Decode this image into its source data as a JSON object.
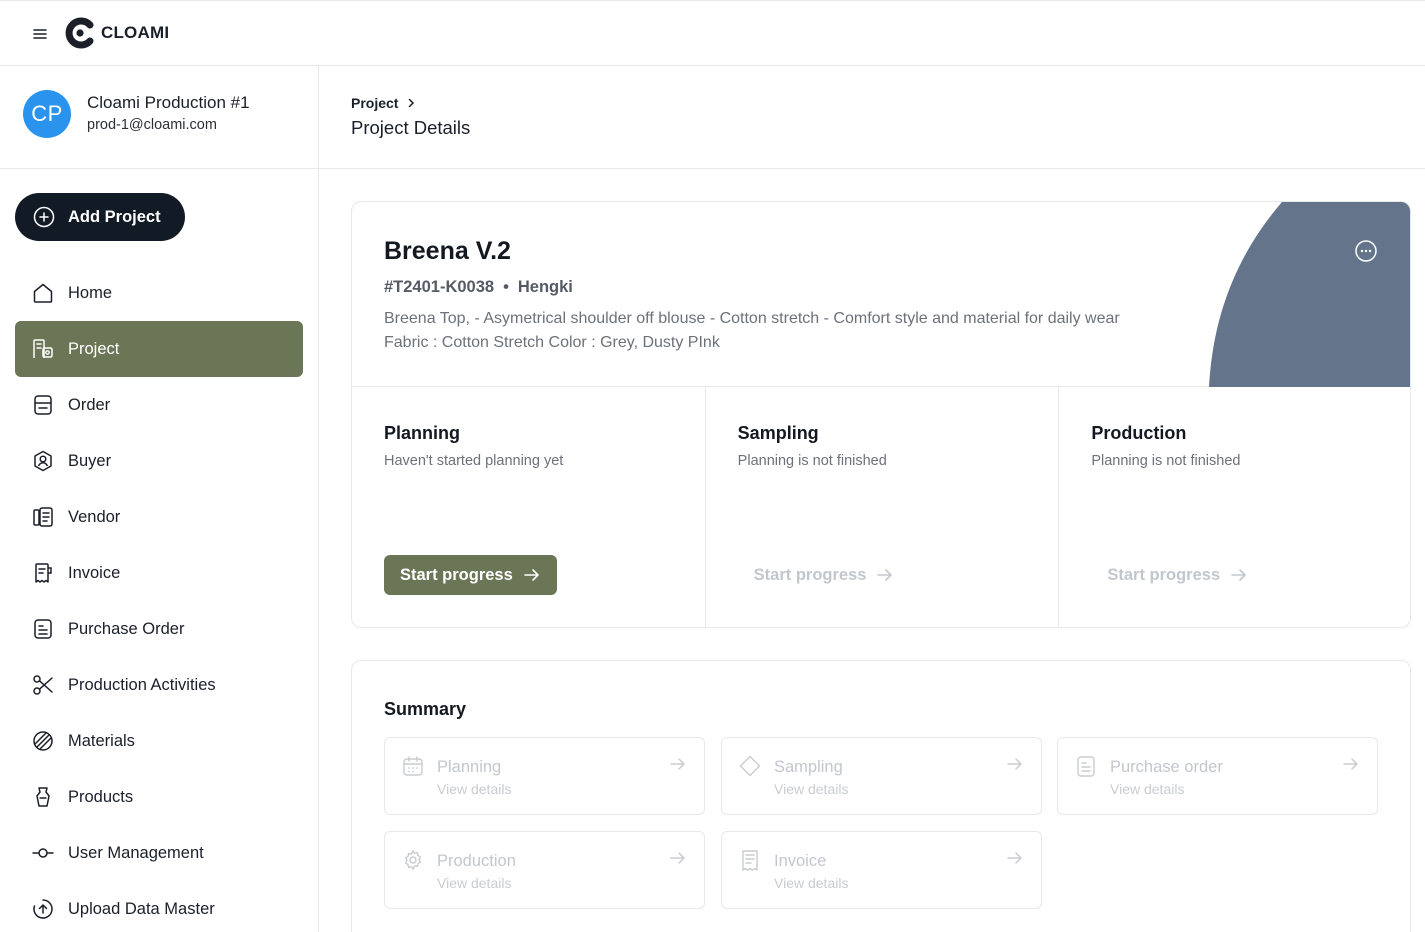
{
  "brand": {
    "name": "CLOAMI"
  },
  "user": {
    "initials": "CP",
    "name": "Cloami Production #1",
    "email": "prod-1@cloami.com"
  },
  "sidebar": {
    "add_label": "Add Project",
    "items": [
      {
        "label": "Home",
        "icon": "home-icon"
      },
      {
        "label": "Project",
        "icon": "project-icon",
        "active": true
      },
      {
        "label": "Order",
        "icon": "order-icon"
      },
      {
        "label": "Buyer",
        "icon": "buyer-icon"
      },
      {
        "label": "Vendor",
        "icon": "vendor-icon"
      },
      {
        "label": "Invoice",
        "icon": "invoice-icon"
      },
      {
        "label": "Purchase Order",
        "icon": "purchase-order-icon"
      },
      {
        "label": "Production Activities",
        "icon": "scissors-icon"
      },
      {
        "label": "Materials",
        "icon": "materials-icon"
      },
      {
        "label": "Products",
        "icon": "products-icon"
      },
      {
        "label": "User Management",
        "icon": "user-management-icon"
      },
      {
        "label": "Upload Data Master",
        "icon": "upload-icon"
      }
    ]
  },
  "header": {
    "breadcrumb": "Project",
    "title": "Project Details"
  },
  "project": {
    "name": "Breena V.2",
    "code": "#T2401-K0038",
    "separator": "•",
    "owner": "Hengki",
    "description": "Breena Top, - Asymetrical shoulder off blouse - Cotton stretch - Comfort style and material for daily wear Fabric : Cotton Stretch Color : Grey, Dusty PInk"
  },
  "stages": [
    {
      "title": "Planning",
      "status": "Haven't started planning yet",
      "button": "Start progress",
      "enabled": true
    },
    {
      "title": "Sampling",
      "status": "Planning is not finished",
      "button": "Start progress",
      "enabled": false
    },
    {
      "title": "Production",
      "status": "Planning is not finished",
      "button": "Start progress",
      "enabled": false
    }
  ],
  "summary": {
    "title": "Summary",
    "tiles": [
      {
        "title": "Planning",
        "sub": "View details",
        "icon": "calendar-icon"
      },
      {
        "title": "Sampling",
        "sub": "View details",
        "icon": "diamond-icon"
      },
      {
        "title": "Purchase order",
        "sub": "View details",
        "icon": "document-icon"
      },
      {
        "title": "Production",
        "sub": "View details",
        "icon": "gear-icon"
      },
      {
        "title": "Invoice",
        "sub": "View details",
        "icon": "receipt-icon"
      }
    ]
  },
  "colors": {
    "accent": "#6b7656",
    "dark_button": "#121a26",
    "avatar": "#2a93ee",
    "hero_shape": "#64748b",
    "muted_text": "#6d717a",
    "disabled_text": "#c3c7cd"
  }
}
